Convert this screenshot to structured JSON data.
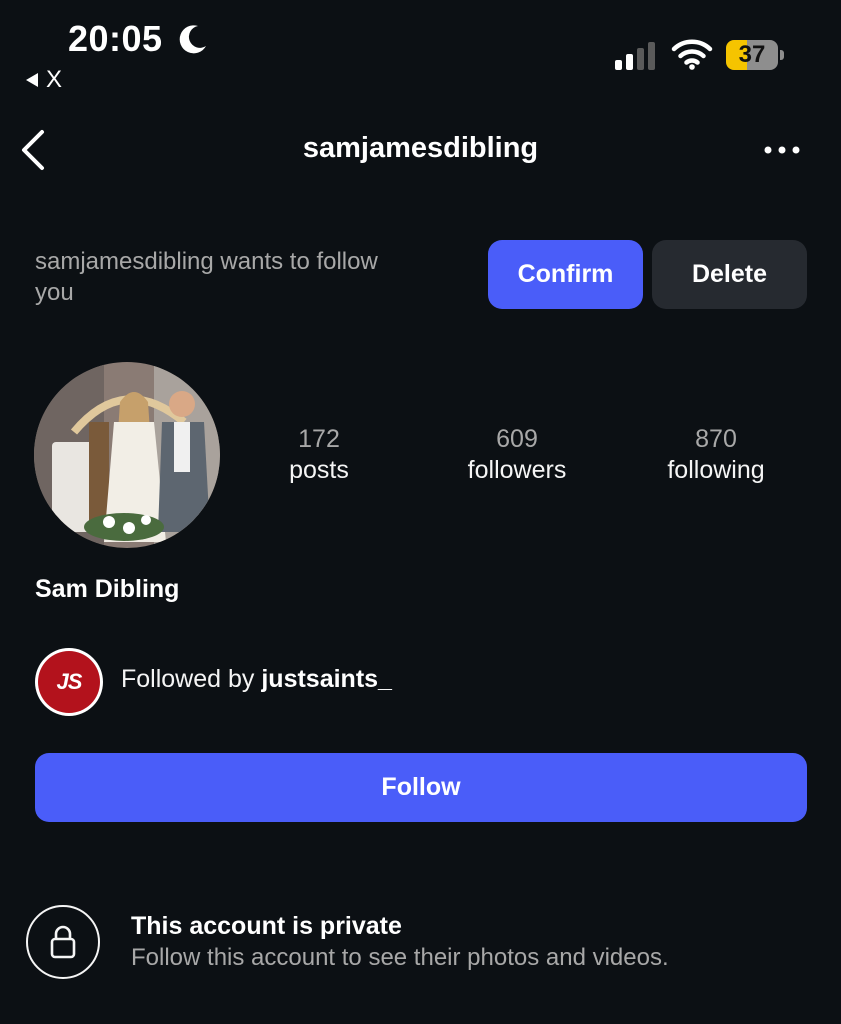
{
  "status_bar": {
    "time": "20:05",
    "back_app_label": "X",
    "battery_level": "37",
    "signal_icon": "cellular-signal-icon",
    "wifi_icon": "wifi-icon",
    "focus_icon": "moon-icon",
    "battery_color": "#f5c400"
  },
  "header": {
    "title": "samjamesdibling",
    "back_icon": "chevron-left-icon",
    "more_icon": "more-horizontal-icon"
  },
  "follow_request": {
    "text": "samjamesdibling wants to follow you",
    "confirm_label": "Confirm",
    "delete_label": "Delete"
  },
  "profile": {
    "stats": {
      "posts_count": "172",
      "posts_label": "posts",
      "followers_count": "609",
      "followers_label": "followers",
      "following_count": "870",
      "following_label": "following"
    },
    "display_name": "Sam Dibling",
    "mutual": {
      "prefix": "Followed by ",
      "username": "justsaints_",
      "avatar_text": "JS"
    },
    "follow_label": "Follow"
  },
  "private_notice": {
    "icon": "lock-icon",
    "title": "This account is private",
    "subtitle": "Follow this account to see their photos and videos."
  },
  "colors": {
    "background": "#0c1014",
    "primary_button": "#4a5df9",
    "secondary_button": "#262a30",
    "muted_text": "#a8a8a8"
  }
}
